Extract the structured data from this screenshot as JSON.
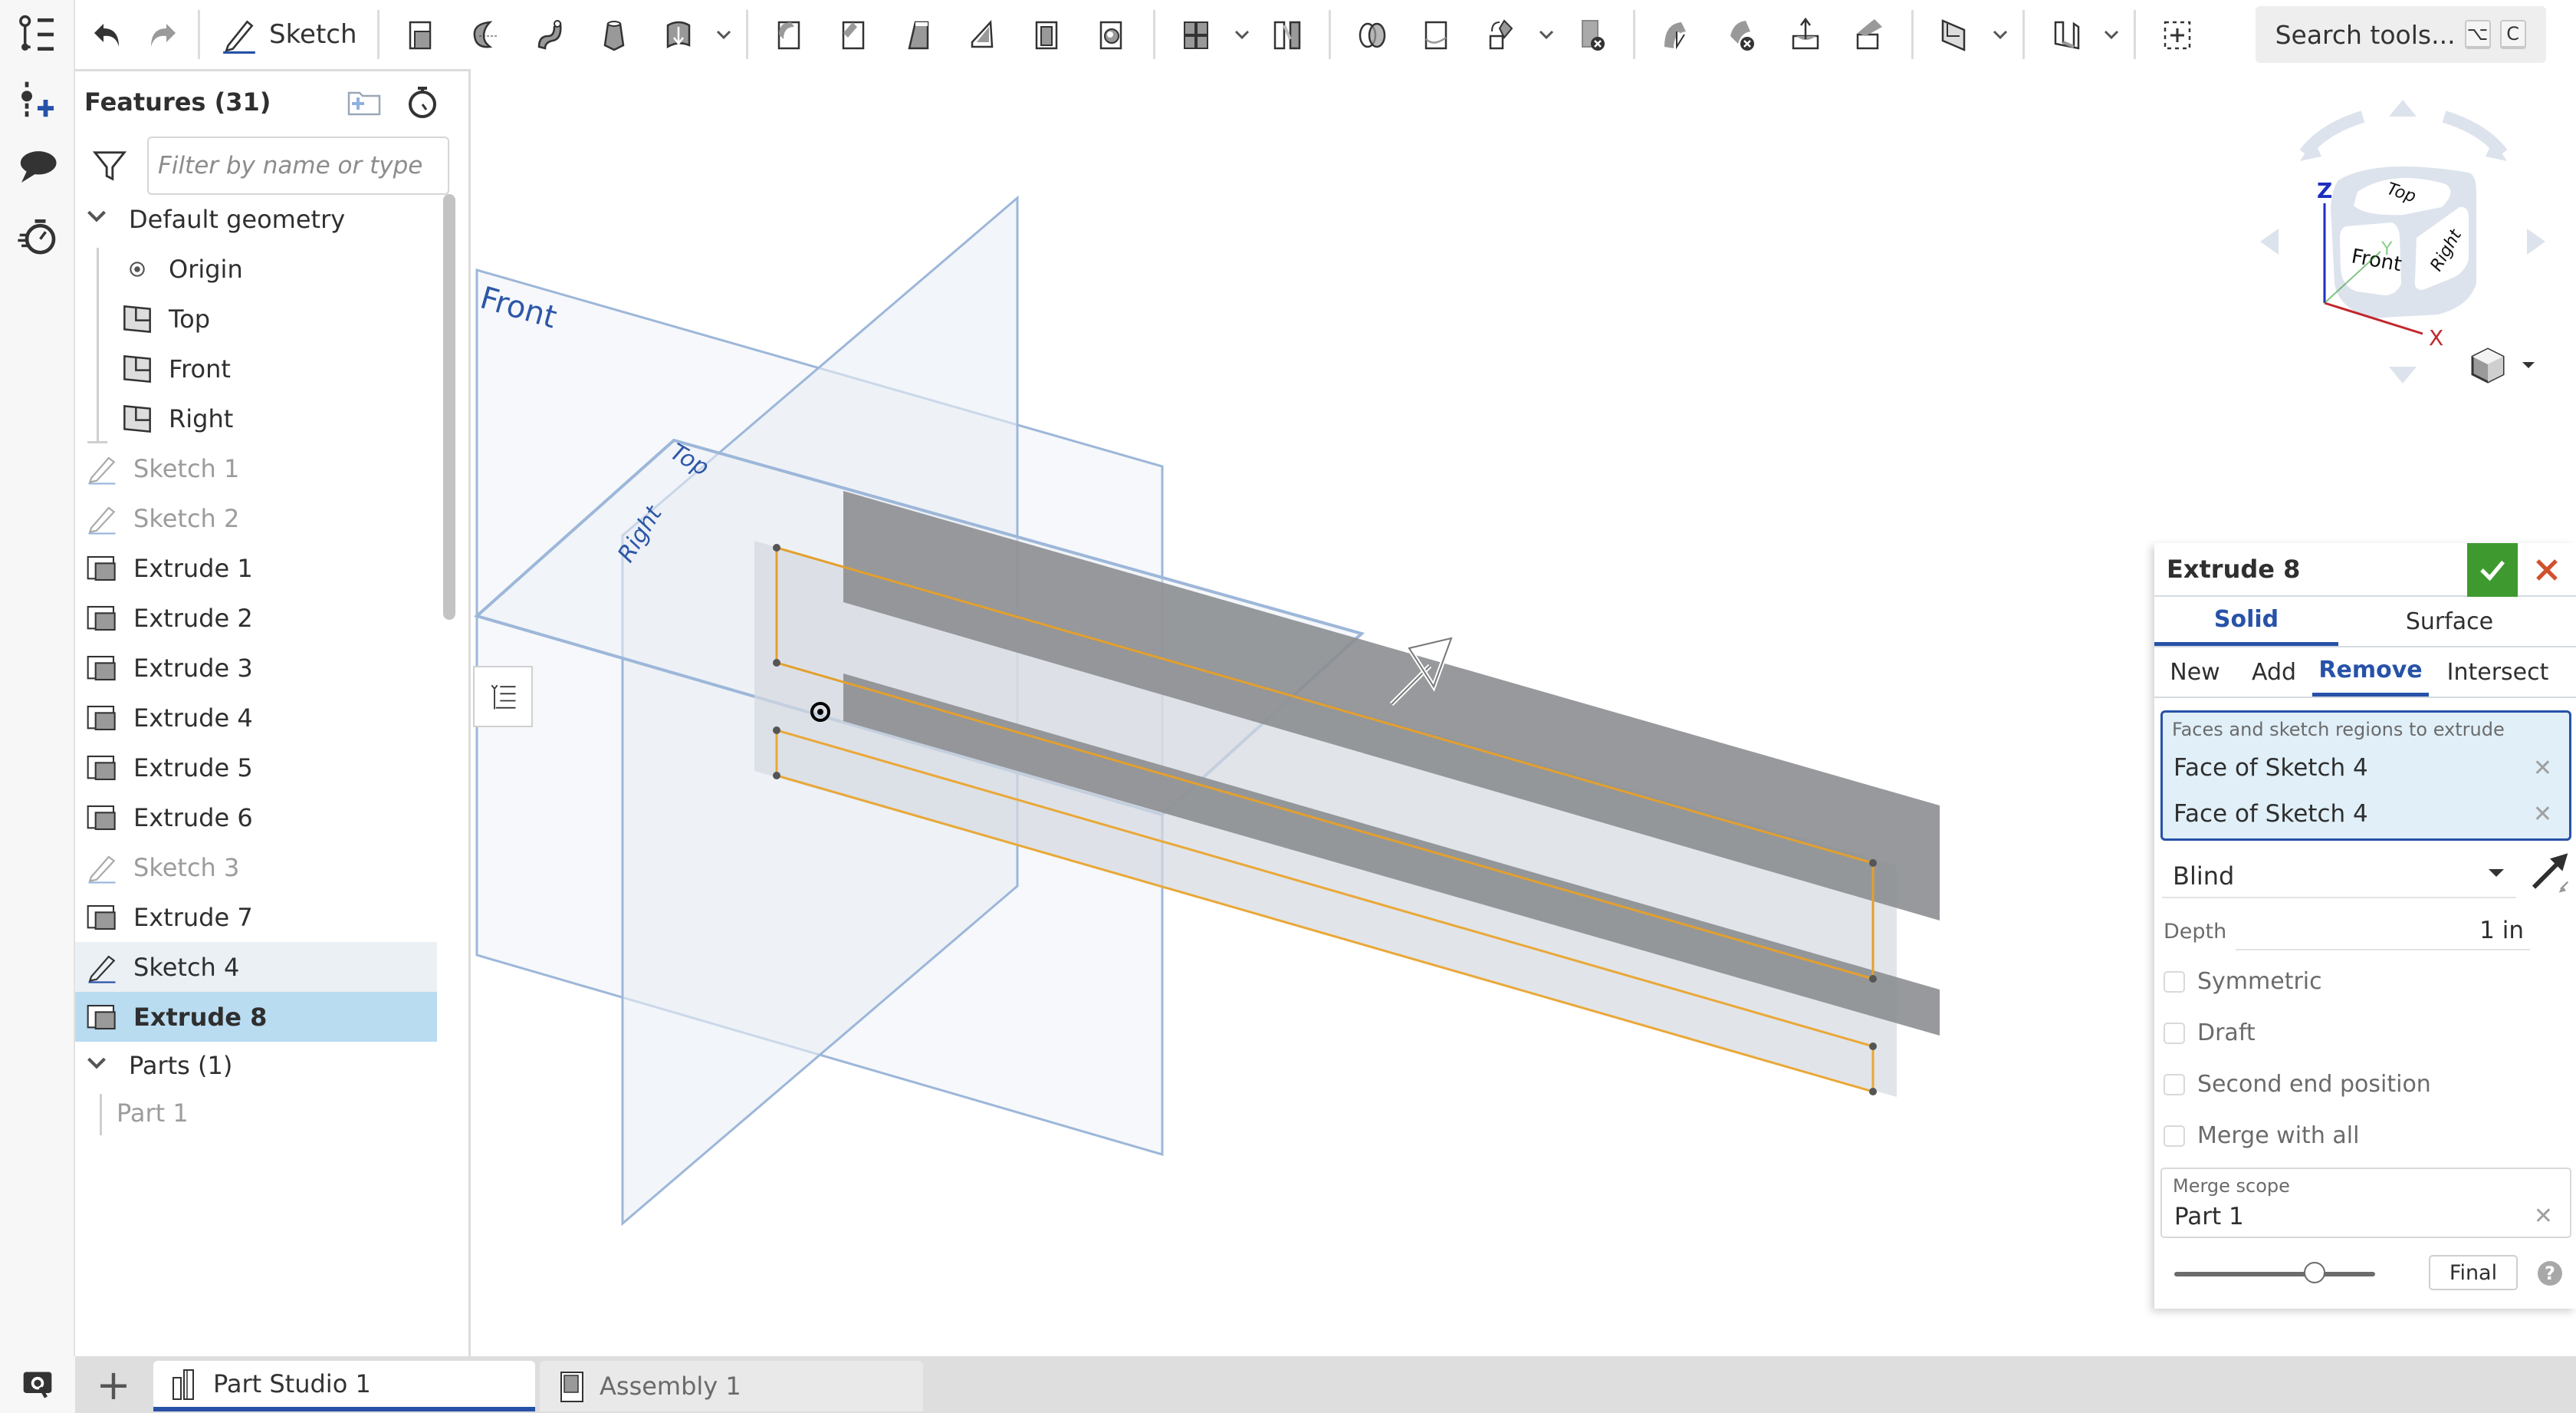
{
  "toolbar": {
    "sketch_label": "Sketch",
    "search_label": "Search tools...",
    "search_shortcut": [
      "⌥",
      "C"
    ],
    "tools": [
      {
        "name": "extrude-icon"
      },
      {
        "name": "revolve-icon"
      },
      {
        "name": "sweep-icon"
      },
      {
        "name": "loft-icon"
      },
      {
        "name": "thicken-icon"
      },
      {
        "name": "fillet-icon"
      },
      {
        "name": "chamfer-icon"
      },
      {
        "name": "draft-icon"
      },
      {
        "name": "rib-icon"
      },
      {
        "name": "shell-icon"
      },
      {
        "name": "hole-icon"
      },
      {
        "name": "pattern-icon"
      },
      {
        "name": "mirror-icon"
      },
      {
        "name": "boolean-icon"
      },
      {
        "name": "split-icon"
      },
      {
        "name": "transform-icon"
      },
      {
        "name": "delete-part-icon"
      },
      {
        "name": "modify-fillet-icon"
      },
      {
        "name": "delete-face-icon"
      },
      {
        "name": "move-face-icon"
      },
      {
        "name": "replace-face-icon"
      },
      {
        "name": "plane-icon"
      },
      {
        "name": "sheet-metal-icon"
      },
      {
        "name": "add-custom-feature-icon"
      }
    ]
  },
  "rail": {
    "items": [
      "feature-list-icon",
      "insert-variable-icon",
      "comments-icon",
      "rollback-timer-icon"
    ]
  },
  "features_panel": {
    "title": "Features (31)",
    "filter_placeholder": "Filter by name or type",
    "default_geometry": {
      "label": "Default geometry",
      "items": [
        {
          "label": "Origin",
          "icon": "origin-icon"
        },
        {
          "label": "Top",
          "icon": "plane-icon"
        },
        {
          "label": "Front",
          "icon": "plane-icon"
        },
        {
          "label": "Right",
          "icon": "plane-icon"
        }
      ]
    },
    "features": [
      {
        "label": "Sketch 1",
        "type": "sketch",
        "state": "dim"
      },
      {
        "label": "Sketch 2",
        "type": "sketch",
        "state": "dim"
      },
      {
        "label": "Extrude 1",
        "type": "extrude",
        "state": "normal"
      },
      {
        "label": "Extrude 2",
        "type": "extrude",
        "state": "normal"
      },
      {
        "label": "Extrude 3",
        "type": "extrude",
        "state": "normal"
      },
      {
        "label": "Extrude 4",
        "type": "extrude",
        "state": "normal"
      },
      {
        "label": "Extrude 5",
        "type": "extrude",
        "state": "normal"
      },
      {
        "label": "Extrude 6",
        "type": "extrude",
        "state": "normal"
      },
      {
        "label": "Sketch 3",
        "type": "sketch",
        "state": "dim"
      },
      {
        "label": "Extrude 7",
        "type": "extrude",
        "state": "normal"
      },
      {
        "label": "Sketch 4",
        "type": "sketch",
        "state": "hover"
      },
      {
        "label": "Extrude 8",
        "type": "extrude",
        "state": "selected"
      }
    ],
    "parts": {
      "label": "Parts (1)",
      "items": [
        {
          "label": "Part 1"
        }
      ]
    }
  },
  "viewport": {
    "plane_labels": {
      "front": "Front",
      "top": "Top",
      "right": "Right"
    },
    "colors": {
      "plane_edge": "#8fafd6",
      "plane_fill": "#e9eef5",
      "sketch_edge": "#e8a634",
      "solid_dark": "#8a8c8f",
      "solid_light": "#9e9e9e"
    }
  },
  "viewcube": {
    "faces": {
      "top": "Top",
      "front": "Front",
      "right": "Right"
    },
    "axes": {
      "x": "X",
      "y": "Y",
      "z": "Z"
    },
    "axis_colors": {
      "x": "#c0282d",
      "y": "#2f9a2f",
      "z": "#1d2fbf"
    }
  },
  "dialog": {
    "title": "Extrude 8",
    "body_types": [
      {
        "label": "Solid",
        "active": true
      },
      {
        "label": "Surface",
        "active": false
      }
    ],
    "operations": [
      {
        "label": "New",
        "active": false
      },
      {
        "label": "Add",
        "active": false
      },
      {
        "label": "Remove",
        "active": true
      },
      {
        "label": "Intersect",
        "active": false
      }
    ],
    "selection_label": "Faces and sketch regions to extrude",
    "selections": [
      "Face of Sketch 4",
      "Face of Sketch 4"
    ],
    "end_type": "Blind",
    "depth_label": "Depth",
    "depth_value": "1 in",
    "checkboxes": [
      {
        "label": "Symmetric",
        "checked": false
      },
      {
        "label": "Draft",
        "checked": false
      },
      {
        "label": "Second end position",
        "checked": false
      },
      {
        "label": "Merge with all",
        "checked": false
      }
    ],
    "merge_scope_label": "Merge scope",
    "merge_scope_value": "Part 1",
    "rollback_slider_fraction": 0.7,
    "final_label": "Final",
    "help_label": "?",
    "ok_color": "#3e9a2f",
    "cancel_color": "#d0512c"
  },
  "tabs": [
    {
      "label": "Part Studio 1",
      "active": true
    },
    {
      "label": "Assembly 1",
      "active": false
    }
  ]
}
